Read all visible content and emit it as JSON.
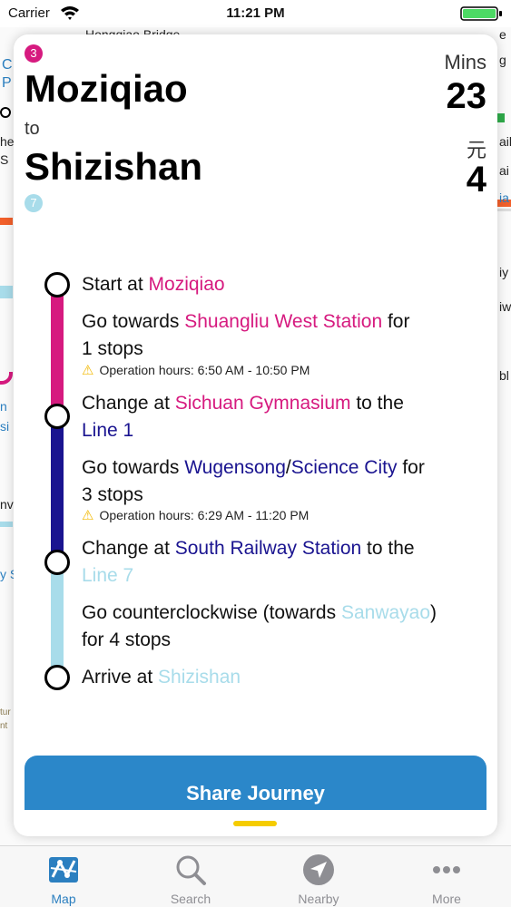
{
  "status_bar": {
    "carrier": "Carrier",
    "time": "11:21 PM"
  },
  "map_background": {
    "labels": [
      "Hongqiao Bridge",
      "C",
      "P",
      "he",
      "S",
      "n",
      "si",
      "nv",
      "y S",
      "tur",
      "nt",
      "g",
      "e",
      "ail",
      "ai",
      "ia",
      "iy",
      "iw",
      "bl"
    ]
  },
  "journey": {
    "origin_line_badge": "3",
    "origin": "Moziqiao",
    "to_label": "to",
    "destination": "Shizishan",
    "destination_line_badge": "7",
    "time_unit": "Mins",
    "time_value": "23",
    "fare_unit": "元",
    "fare_value": "4"
  },
  "colors": {
    "line3": "#d61a7f",
    "line1": "#1a1490",
    "line7": "#a8dcea",
    "accent": "#2b87c9",
    "warning": "#f2b800",
    "grabber": "#f5cc00"
  },
  "steps": {
    "s1": {
      "prefix": "Start at ",
      "station": "Moziqiao"
    },
    "s2": {
      "prefix": "Go towards ",
      "station": "Shuangliu West Station",
      "suffix": " for",
      "line2": "1 stops"
    },
    "note1": {
      "icon": "warning-icon",
      "text": "Operation hours: 6:50 AM - 10:50 PM"
    },
    "s3": {
      "prefix": "Change at ",
      "station": "Sichuan Gymnasium",
      "suffix": " to the",
      "line_name": "Line 1"
    },
    "s4": {
      "prefix": "Go towards ",
      "station_a": "Wugensong",
      "sep": "/",
      "station_b": "Science City",
      "suffix": " for",
      "line2": "3 stops"
    },
    "note2": {
      "icon": "warning-icon",
      "text": "Operation hours: 6:29 AM - 11:20 PM"
    },
    "s5": {
      "prefix": "Change at ",
      "station": "South Railway Station",
      "suffix": " to the",
      "line_name": "Line 7"
    },
    "s6": {
      "prefix": "Go counterclockwise (towards ",
      "station": "Sanwayao",
      "suffix": ")",
      "line2": "for 4 stops"
    },
    "s7": {
      "prefix": "Arrive at ",
      "station": "Shizishan"
    }
  },
  "share_button": "Share Journey",
  "tabs": [
    {
      "label": "Map",
      "icon": "map-icon",
      "active": true
    },
    {
      "label": "Search",
      "icon": "search-icon",
      "active": false
    },
    {
      "label": "Nearby",
      "icon": "location-arrow-icon",
      "active": false
    },
    {
      "label": "More",
      "icon": "more-icon",
      "active": false
    }
  ]
}
